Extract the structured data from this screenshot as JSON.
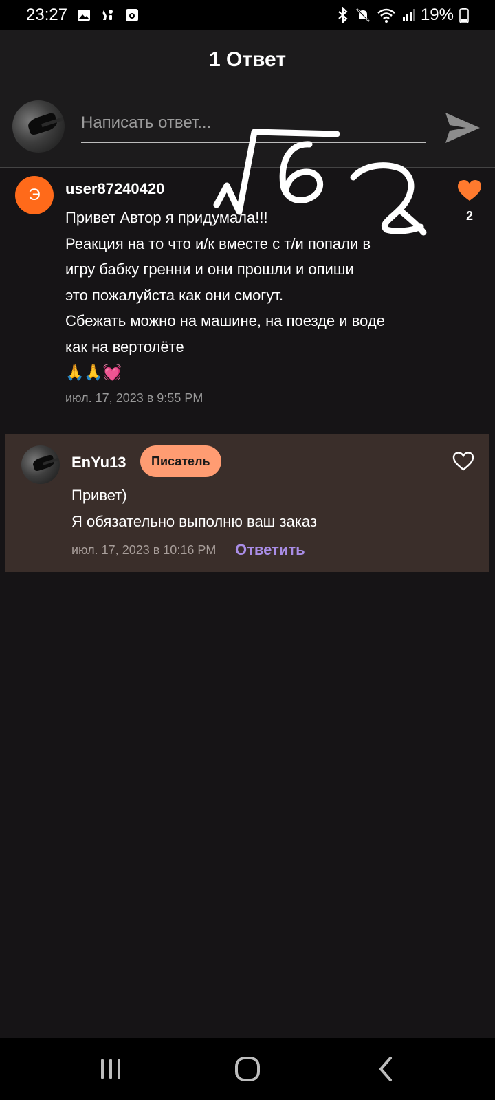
{
  "status_bar": {
    "time": "23:27",
    "battery": "19%",
    "icons": [
      "gallery-icon",
      "notification-icon",
      "media-icon",
      "bluetooth-icon",
      "mute-icon",
      "wifi-icon",
      "signal-icon",
      "battery-icon"
    ]
  },
  "header": {
    "title": "1 Ответ"
  },
  "composer": {
    "placeholder": "Написать ответ...",
    "send_icon": "send-icon"
  },
  "comment": {
    "avatar_letter": "Э",
    "avatar_color": "#ff6a1a",
    "username": "user87240420",
    "lines": [
      "Привет Автор я придумала!!!",
      "Реакция на то что и/к вместе с т/и попали в",
      "игру бабку гренни и они прошли и опиши",
      "это пожалуйста как они смогут.",
      "Сбежать можно на машине, на поезде и воде",
      "как на вертолёте"
    ],
    "emojis": "🙏🙏💓",
    "timestamp": "июл. 17, 2023 в 9:55 PM",
    "likes": "2",
    "like_color": "#ff7a2e"
  },
  "reply": {
    "username": "EnYu13",
    "badge": "Писатель",
    "badge_color": "#ff9c72",
    "lines": [
      "Привет)",
      "Я обязательно выполню ваш заказ"
    ],
    "timestamp": "июл. 17, 2023 в 10:16 PM",
    "reply_action": "Ответить",
    "action_color": "#a98de6",
    "background": "#3a2e2a"
  },
  "nav_bar": {
    "icons": [
      "recents-icon",
      "home-icon",
      "back-icon"
    ]
  }
}
